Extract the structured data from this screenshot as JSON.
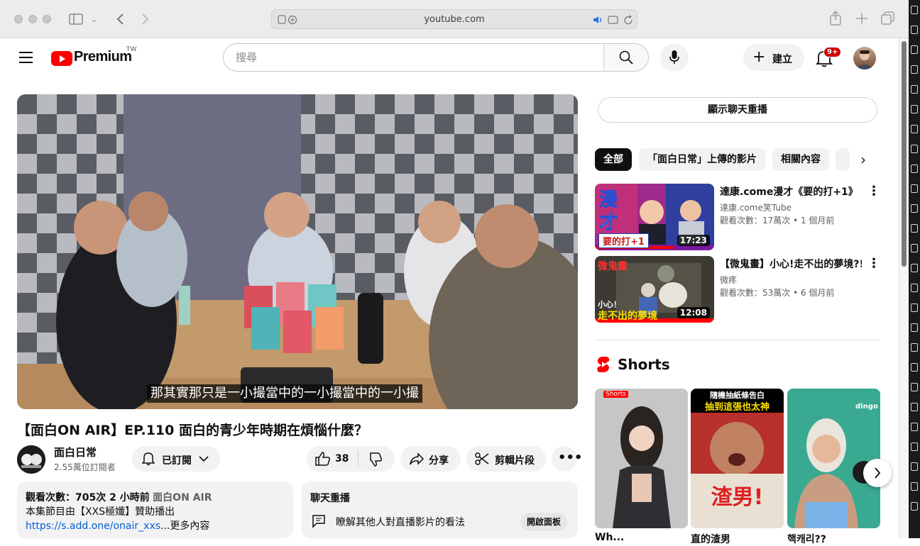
{
  "browser": {
    "url": "youtube.com"
  },
  "header": {
    "logo_text": "Premium",
    "region": "TW",
    "search_placeholder": "搜尋",
    "create_label": "建立",
    "notification_count": "9+"
  },
  "video": {
    "caption": "那其實那只是一小撮當中的一小撮當中的一小撮",
    "title": "【面白ON AIR】EP.110 面白的青少年時期在煩惱什麼？",
    "channel_name": "面白日常",
    "subscribers": "2.55萬位訂閱者",
    "subscribe_label": "已訂閱",
    "likes": "38",
    "share_label": "分享",
    "clip_label": "剪輯片段"
  },
  "description": {
    "stats": "觀看次數：705次  2 小時前",
    "tag": "面白ON AIR",
    "line2": "本集節目由【XXS極孅】贊助播出",
    "link": "https://s.add.one/onair_xxs",
    "more": "...更多內容"
  },
  "chat_replay": {
    "title": "聊天重播",
    "text": "瞭解其他人對直播影片的看法",
    "open_label": "開啟面板"
  },
  "sidebar": {
    "show_chat": "顯示聊天重播",
    "chips": [
      "全部",
      "「面白日常」上傳的影片",
      "相關內容"
    ],
    "recommendations": [
      {
        "title": "達康.come漫才《要的打+1》",
        "channel": "達康.come笑Tube",
        "meta": "觀看次數：17萬次 • 1 個月前",
        "duration": "17:23",
        "thumb_text_1": "漫",
        "thumb_text_2": "才",
        "thumb_caption": "要的打+1"
      },
      {
        "title": "【微鬼畫】小心!走不出的夢境?!",
        "channel": "微疼",
        "meta": "觀看次數：53萬次 • 6 個月前",
        "duration": "12:08",
        "thumb_tag": "微鬼畫",
        "thumb_text_1": "小心！",
        "thumb_text_2": "走不出的夢境"
      }
    ],
    "shorts_title": "Shorts",
    "shorts": [
      {
        "overlay": "Shorts",
        "caption": "Wh...",
        "accent": "#3a3a3a"
      },
      {
        "overlay": "隨機抽紙條告白",
        "overlay2": "抽到這張也太神",
        "big_text": "渣男!",
        "caption": "直的渣男",
        "accent": "#d9423a"
      },
      {
        "overlay": "dingo",
        "caption": "핵캐리??",
        "accent": "#2fa38f"
      }
    ]
  }
}
